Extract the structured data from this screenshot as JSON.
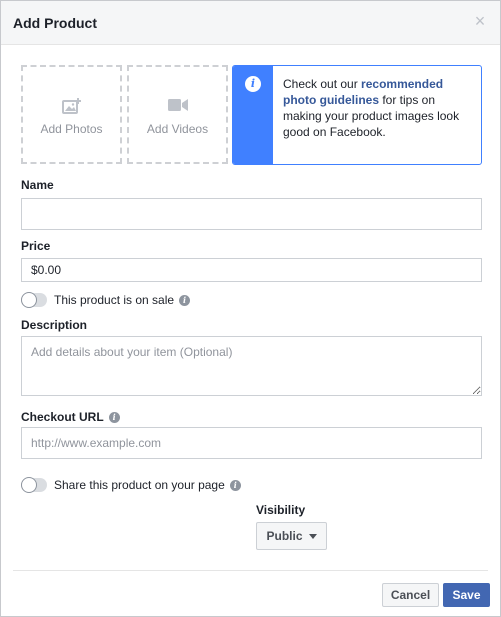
{
  "dialog": {
    "title": "Add Product",
    "close_glyph": "×"
  },
  "media": {
    "photos_label": "Add Photos",
    "photos_icon": "add-photo-icon",
    "videos_label": "Add Videos",
    "videos_icon": "video-camera-icon"
  },
  "info": {
    "icon": "info-icon",
    "icon_glyph": "i",
    "text_before": "Check out our ",
    "link_text": "recommended photo guidelines",
    "text_after": " for tips on making your product images look good on Facebook."
  },
  "fields": {
    "name_label": "Name",
    "name_value": "",
    "price_label": "Price",
    "price_value": "$0.00",
    "sale_label": "This product is on sale",
    "sale_on": false,
    "description_label": "Description",
    "description_placeholder": "Add details about your item (Optional)",
    "checkout_label": "Checkout URL",
    "checkout_placeholder": "http://www.example.com",
    "share_label": "Share this product on your page",
    "share_on": false,
    "help_glyph": "i"
  },
  "visibility": {
    "label": "Visibility",
    "selected": "Public"
  },
  "footer": {
    "cancel_label": "Cancel",
    "save_label": "Save"
  },
  "colors": {
    "accent": "#4080ff",
    "primary_button": "#4267b2",
    "link": "#365899"
  }
}
